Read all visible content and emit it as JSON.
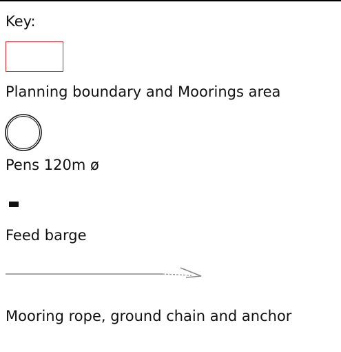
{
  "legend": {
    "title": "Key:",
    "items": [
      {
        "label": "Planning boundary and Moorings area",
        "color": "#e02020"
      },
      {
        "label": "Pens 120m ø",
        "color": "#111111"
      },
      {
        "label": "Feed barge",
        "color": "#111111"
      },
      {
        "label": "Mooring rope, ground chain and anchor",
        "color": "#808080"
      }
    ]
  }
}
